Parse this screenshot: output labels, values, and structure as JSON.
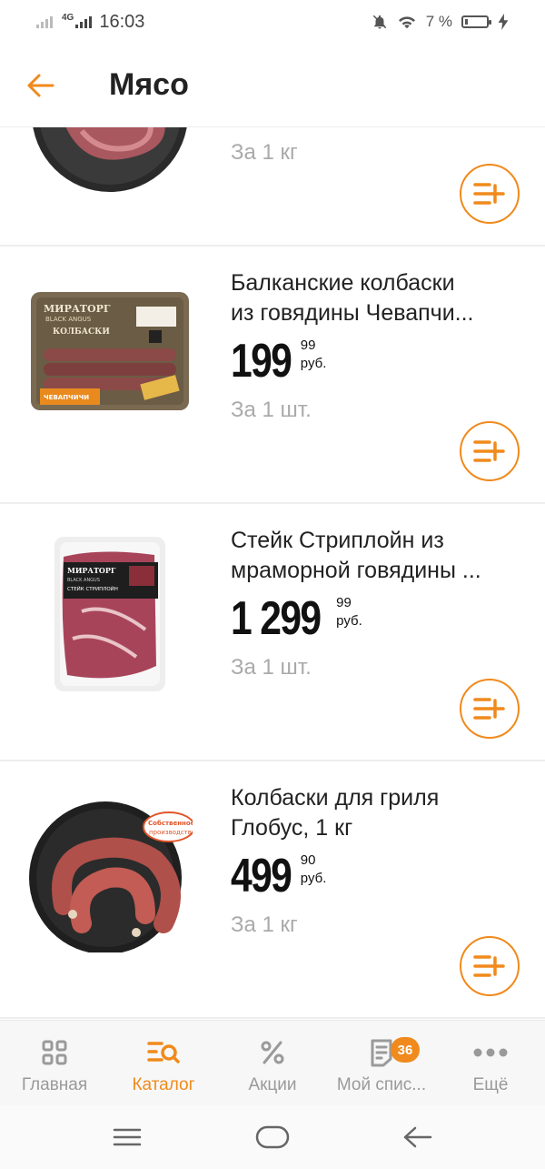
{
  "status": {
    "time": "16:03",
    "network": "4G",
    "battery_percent": "7 %"
  },
  "header": {
    "title": "Мясо",
    "back_icon": "arrow-left-icon"
  },
  "colors": {
    "accent": "#f08a1c",
    "muted": "#aaaaaa"
  },
  "products": [
    {
      "name_line1": "",
      "name_line2": "",
      "price_main": "",
      "price_kop": "",
      "currency": "",
      "unit": "За 1 кг",
      "image": "beef-steak-plate"
    },
    {
      "name_line1": "Балканские колбаски",
      "name_line2": "из говядины Чевапчи...",
      "price_main": "199",
      "price_kop": "99",
      "currency": "руб.",
      "unit": "За 1 шт.",
      "image": "sausage-pack",
      "package_brand": "МИРАТОРГ",
      "package_line": "BLACK ANGUS",
      "package_title": "КОЛБАСКИ",
      "package_variety": "ЧЕВАПЧИЧИ"
    },
    {
      "name_line1": "Стейк Стриплойн из",
      "name_line2": "мраморной говядины ...",
      "price_main": "1 299",
      "price_kop": "99",
      "currency": "руб.",
      "unit": "За 1 шт.",
      "image": "steak-pack",
      "package_brand": "МИРАТОРГ",
      "package_line": "BLACK ANGUS",
      "package_title": "СТЕЙК СТРИПЛОЙН"
    },
    {
      "name_line1": "Колбаски для гриля",
      "name_line2": "Глобус, 1 кг",
      "price_main": "499",
      "price_kop": "90",
      "currency": "руб.",
      "unit": "За 1 кг",
      "image": "grill-sausages-plate",
      "stamp_line1": "Собственное",
      "stamp_line2": "производство"
    }
  ],
  "bottom_nav": [
    {
      "label": "Главная",
      "icon": "grid-icon",
      "active": false
    },
    {
      "label": "Каталог",
      "icon": "catalog-search-icon",
      "active": true
    },
    {
      "label": "Акции",
      "icon": "percent-icon",
      "active": false
    },
    {
      "label": "Мой спис...",
      "icon": "list-icon",
      "active": false,
      "badge": "36"
    },
    {
      "label": "Ещё",
      "icon": "more-dots-icon",
      "active": false
    }
  ]
}
